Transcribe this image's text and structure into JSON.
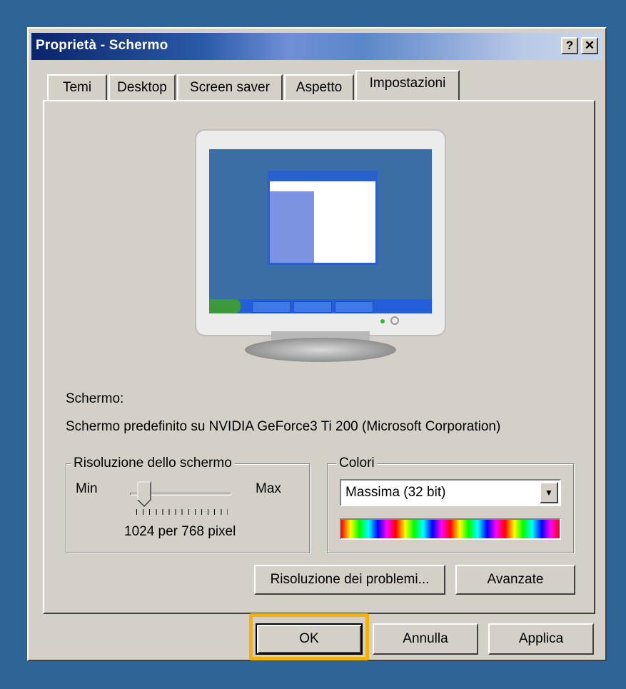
{
  "window": {
    "title": "Proprietà - Schermo",
    "help_button": "?",
    "close_button": "✕"
  },
  "tabs": [
    "Temi",
    "Desktop",
    "Screen saver",
    "Aspetto",
    "Impostazioni"
  ],
  "active_tab": "Impostazioni",
  "display": {
    "label": "Schermo:",
    "device": "Schermo predefinito su NVIDIA GeForce3 Ti 200 (Microsoft Corporation)"
  },
  "resolution": {
    "legend": "Risoluzione dello schermo",
    "min_label": "Min",
    "max_label": "Max",
    "value_text": "1024 per 768 pixel"
  },
  "colors": {
    "legend": "Colori",
    "selected": "Massima (32 bit)"
  },
  "buttons": {
    "troubleshoot": "Risoluzione dei problemi...",
    "advanced": "Avanzate",
    "ok": "OK",
    "cancel": "Annulla",
    "apply": "Applica"
  },
  "theme_colors": {
    "desktop_background": "#2f6497",
    "dialog_face": "#d4d0c8",
    "highlight": "#f5b300"
  }
}
